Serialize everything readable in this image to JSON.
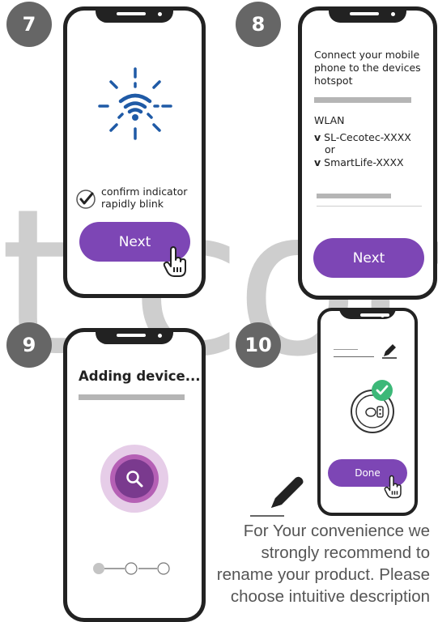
{
  "watermark": "t.com",
  "steps": [
    {
      "number": "7",
      "confirm_text": "confirm indicator rapidly blink",
      "button_label": "Next"
    },
    {
      "number": "8",
      "instruction": "Connect your mobile phone to the devices hotspot",
      "wlan_label": "WLAN",
      "options": [
        "SL-Cecotec-XXXX",
        "SmartLife-XXXX"
      ],
      "option_marker": "v",
      "or_text": "or",
      "button_label": "Next"
    },
    {
      "number": "9",
      "title": "Adding device...",
      "progress_step": 1,
      "progress_total": 3
    },
    {
      "number": "10",
      "button_label": "Done"
    }
  ],
  "caption": "For Your convenience we strongly recommend to rename your product. Please choose intuitive description",
  "colors": {
    "purple": "#7d46b5",
    "badge": "#666666",
    "wifi": "#1f5aa6",
    "check": "#3cb878",
    "frame": "#222222"
  },
  "icons": {
    "wifi": "wifi-icon",
    "check": "checkmark-icon",
    "hand": "hand-pointer-icon",
    "search": "search-icon",
    "pencil": "pencil-icon",
    "robot": "robot-vacuum-icon"
  }
}
